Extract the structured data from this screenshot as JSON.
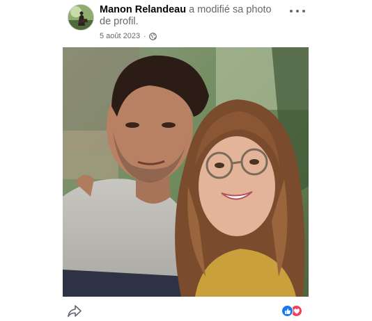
{
  "post": {
    "author": "Manon Relandeau",
    "action_text": " a modifié sa photo de profil.",
    "date": "5 août 2023",
    "separator": "·",
    "audience_icon": "globe-icon",
    "more_icon": "more-horizontal-icon"
  },
  "photo": {
    "subject": "profile-photo"
  },
  "actions": {
    "share_icon": "share-arrow-icon",
    "reactions": [
      "like-reaction-icon",
      "love-reaction-icon"
    ]
  },
  "colors": {
    "text_primary": "#050505",
    "text_secondary": "#65676b",
    "like_blue": "#1877f2",
    "love_red": "#f33e58"
  }
}
